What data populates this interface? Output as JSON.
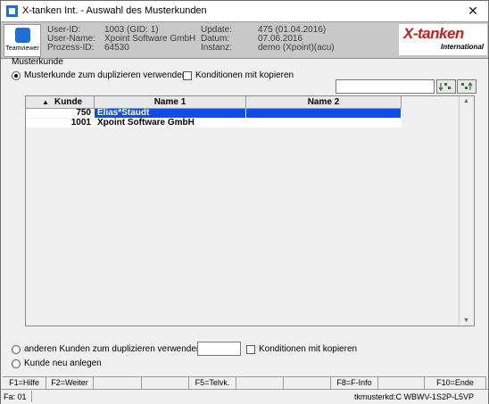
{
  "window": {
    "title": "X-tanken Int. - Auswahl des Musterkunden",
    "close_glyph": "✕"
  },
  "header": {
    "teamviewer_label": "Teamviewer",
    "fields": {
      "user_id_label": "User-ID:",
      "user_id_value": "1003 (GID: 1)",
      "user_name_label": "User-Name:",
      "user_name_value": "Xpoint Software GmbH",
      "prozess_id_label": "Prozess-ID:",
      "prozess_id_value": "64530",
      "update_label": "Update:",
      "update_value": "475 (01.04.2016)",
      "datum_label": "Datum:",
      "datum_value": "07.06.2016",
      "instanz_label": "Instanz:",
      "instanz_value": "demo (Xpoint)(acu)"
    },
    "brand": {
      "name": "X-tanken",
      "sub": "International",
      "color": "#c81e1e"
    }
  },
  "form": {
    "group_label": "Musterkunde",
    "option_use_template": "Musterkunde zum duplizieren verwenden",
    "copy_conditions": "Konditionen mit kopieren",
    "search_value": "",
    "option_other_customer": "anderen Kunden zum duplizieren verwenden",
    "other_customer_value": "",
    "copy_conditions_2": "Konditionen mit kopieren",
    "option_new_customer": "Kunde neu anlegen"
  },
  "table": {
    "columns": [
      "Kunde",
      "Name 1",
      "Name 2"
    ],
    "rows": [
      {
        "kunde": "750",
        "name1": "Elias*Staudt",
        "name2": "",
        "selected": true
      },
      {
        "kunde": "1001",
        "name1": "Xpoint Software GmbH",
        "name2": "",
        "selected": false
      }
    ]
  },
  "function_keys": [
    "F1=Hilfe",
    "F2=Weiter",
    "",
    "",
    "F5=Telvk.",
    "",
    "",
    "F8=F-Info",
    "",
    "F10=Ende"
  ],
  "status": {
    "left": "Fa: 01",
    "right": "tkmusterkd:C WBWV-1S2P-L5VP"
  },
  "colors": {
    "selection": "#0b4fe8",
    "header_bg": "#c8c8c8"
  }
}
